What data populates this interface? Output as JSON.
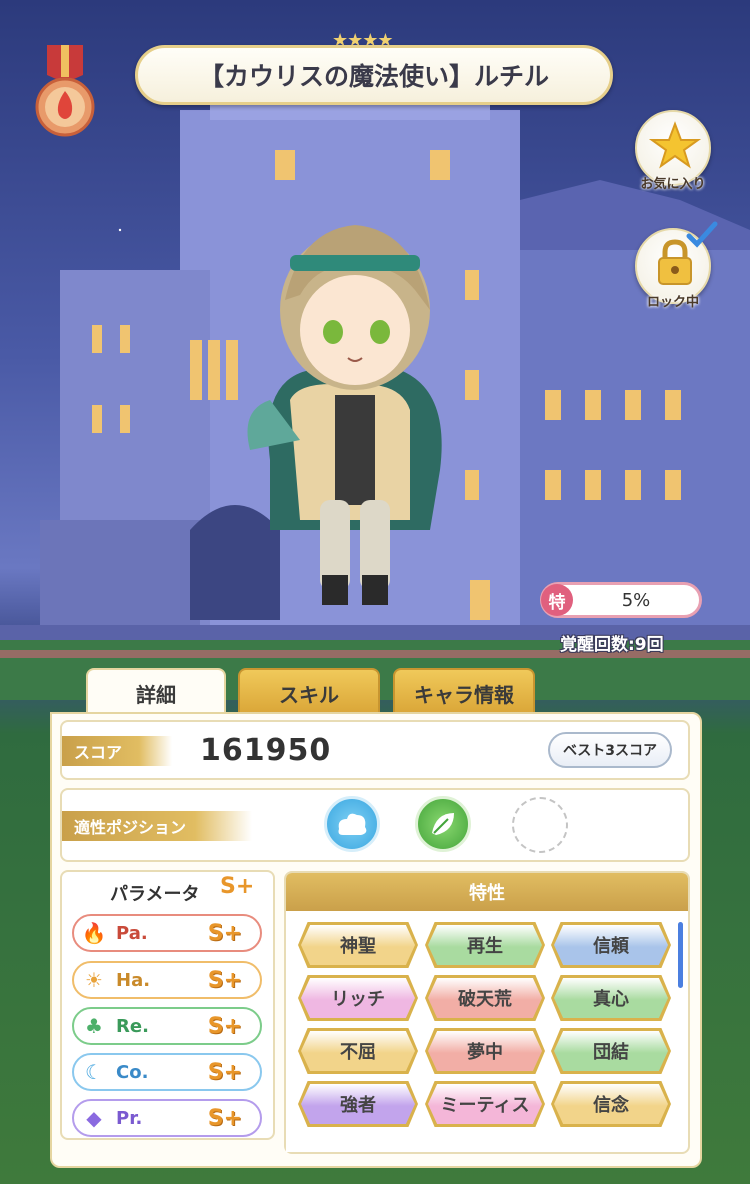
{
  "header": {
    "title": "【カウリスの魔法使い】ルチル",
    "rarity_stars": "★★★★"
  },
  "side_buttons": {
    "favorite_label": "お気に入り",
    "lock_label": "ロック中"
  },
  "awakening": {
    "badge": "特",
    "percent": "5%",
    "count_text": "覚醒回数:9回"
  },
  "tabs": [
    {
      "label": "詳細",
      "active": true
    },
    {
      "label": "スキル",
      "active": false
    },
    {
      "label": "キャラ情報",
      "active": false
    }
  ],
  "score": {
    "label": "スコア",
    "value": "161950",
    "best_button": "ベスト3スコア"
  },
  "position": {
    "label": "適性ポジション",
    "icons": [
      "cloud-position-icon",
      "leaf-position-icon",
      "empty-position-icon"
    ]
  },
  "parameters": {
    "title": "パラメータ",
    "overall_grade": "S+",
    "rows": [
      {
        "name": "Pa.",
        "grade": "S+",
        "icon": "flame-icon",
        "color": "#e0604a"
      },
      {
        "name": "Ha.",
        "grade": "S+",
        "icon": "sun-icon",
        "color": "#e8a23a"
      },
      {
        "name": "Re.",
        "grade": "S+",
        "icon": "clover-icon",
        "color": "#4db06a"
      },
      {
        "name": "Co.",
        "grade": "S+",
        "icon": "planet-icon",
        "color": "#4aa8e0"
      },
      {
        "name": "Pr.",
        "grade": "S+",
        "icon": "diamond-icon",
        "color": "#8a6ae0"
      }
    ]
  },
  "traits": {
    "title": "特性",
    "items": [
      {
        "label": "神聖",
        "color": "#f2d48a"
      },
      {
        "label": "再生",
        "color": "#a9dba0"
      },
      {
        "label": "信頼",
        "color": "#a9c4ea"
      },
      {
        "label": "リッチ",
        "color": "#efb7e2"
      },
      {
        "label": "破天荒",
        "color": "#f2aea6"
      },
      {
        "label": "真心",
        "color": "#a9dba0"
      },
      {
        "label": "不屈",
        "color": "#f2d48a"
      },
      {
        "label": "夢中",
        "color": "#f2aea6"
      },
      {
        "label": "団結",
        "color": "#a9dba0"
      },
      {
        "label": "強者",
        "color": "#c2a4ec"
      },
      {
        "label": "ミーティス",
        "color": "#f4b6d8"
      },
      {
        "label": "信念",
        "color": "#f2d48a"
      }
    ]
  }
}
